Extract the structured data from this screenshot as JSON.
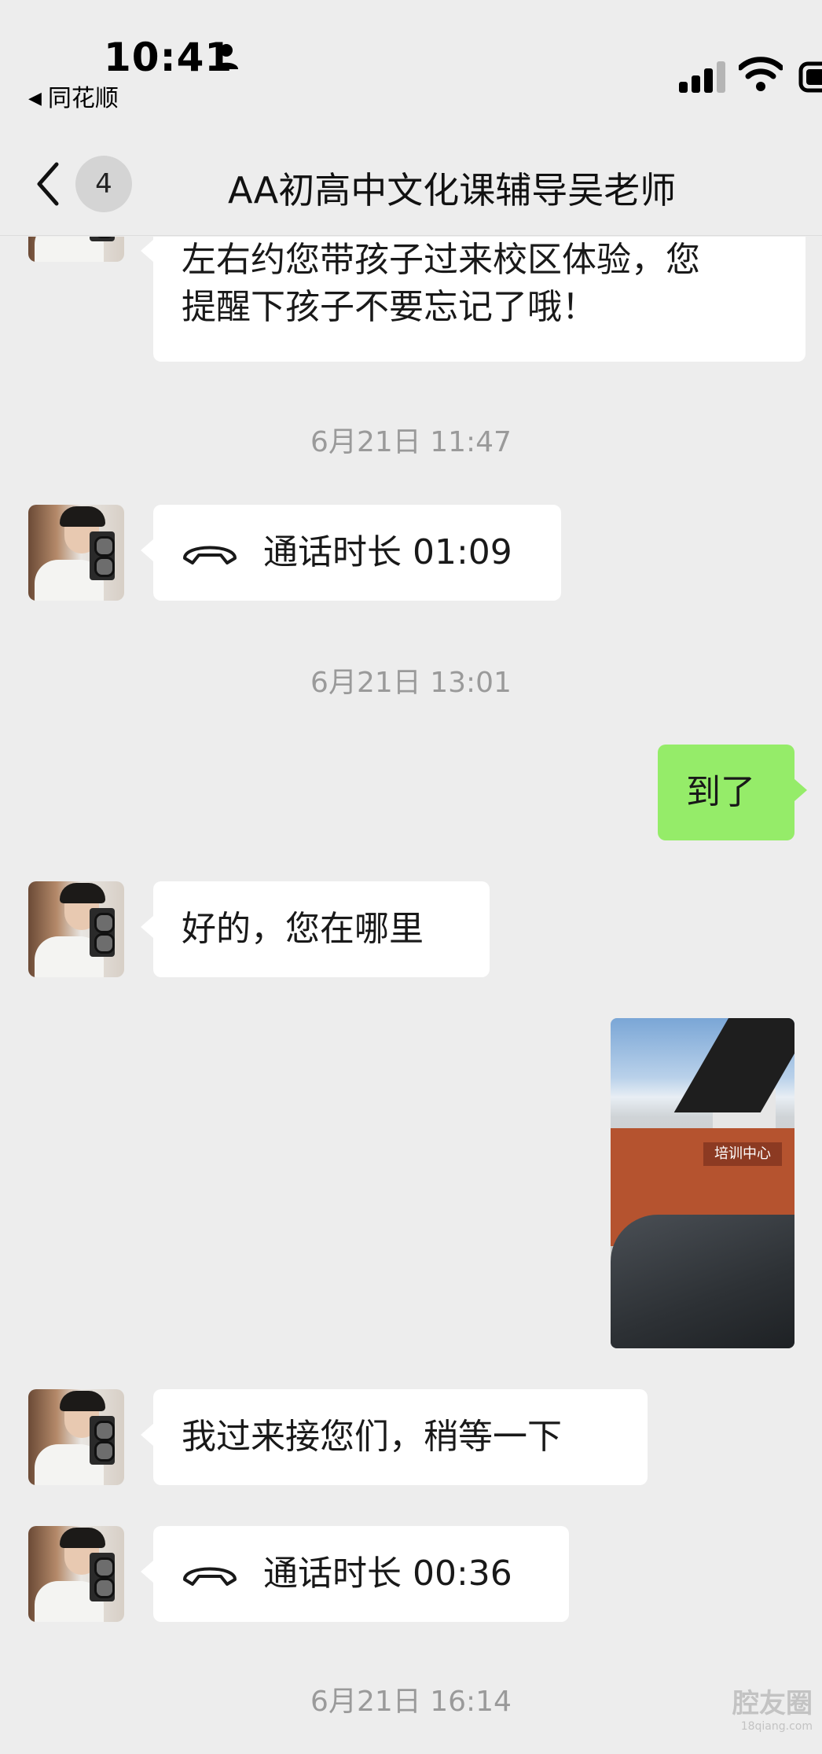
{
  "status_bar": {
    "time": "10:41",
    "back_app": "同花顺",
    "back_arrow": "◀"
  },
  "nav": {
    "unread_count": "4",
    "title": "AA初高中文化课辅导吴老师"
  },
  "messages": [
    {
      "type": "text",
      "side": "left",
      "lines": [
        "左右约您带孩子过来校区体验，您",
        "提醒下孩子不要忘记了哦！"
      ]
    },
    {
      "type": "timestamp",
      "text": "6月21日 11:47"
    },
    {
      "type": "call",
      "side": "left",
      "label": "通话时长 01:09"
    },
    {
      "type": "timestamp",
      "text": "6月21日 13:01"
    },
    {
      "type": "text",
      "side": "right",
      "text": "到了"
    },
    {
      "type": "text",
      "side": "left",
      "text": "好的，您在哪里"
    },
    {
      "type": "image",
      "side": "right",
      "sign_text": "培训中心"
    },
    {
      "type": "text",
      "side": "left",
      "text": "我过来接您们，稍等一下"
    },
    {
      "type": "call",
      "side": "left",
      "label": "通话时长 00:36"
    },
    {
      "type": "timestamp",
      "text": "6月21日 16:14"
    }
  ],
  "watermark": {
    "title": "腔友圈",
    "site": "18qiang.com"
  },
  "colors": {
    "background": "#ededed",
    "self_bubble": "#95ec69",
    "other_bubble": "#ffffff"
  }
}
